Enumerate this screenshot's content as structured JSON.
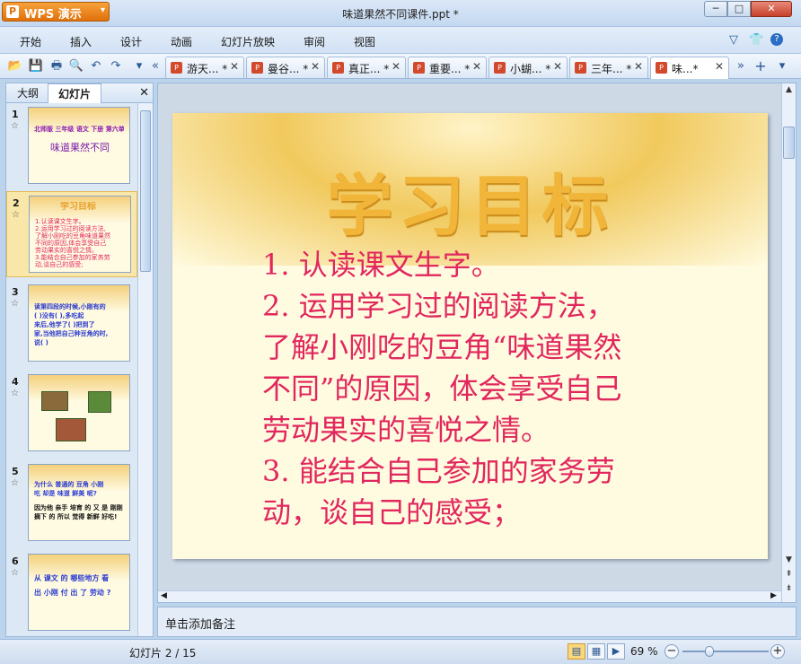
{
  "app": {
    "name": "WPS 演示",
    "logo_letter": "P",
    "doc_title": "味道果然不同课件.ppt *",
    "window_controls": {
      "minimize": "─",
      "maximize": "□",
      "close": "✕"
    }
  },
  "menu": {
    "items": [
      "开始",
      "插入",
      "设计",
      "动画",
      "幻灯片放映",
      "审阅",
      "视图"
    ],
    "right_icons": [
      "▽",
      "👕",
      "?"
    ]
  },
  "toolbar": {
    "icons": [
      "open-icon",
      "save-icon",
      "print-icon",
      "preview-icon",
      "undo-icon",
      "redo-icon",
      "dropdown-icon",
      "tab-prev-icon"
    ],
    "glyphs": [
      "📂",
      "💾",
      "🖶",
      "🔍",
      "↶",
      "↷",
      "▾",
      "«"
    ],
    "tab_next": "»",
    "new_tab": "+",
    "tab_menu": "▾",
    "tabs": [
      {
        "label": "游天... *",
        "close": "✕"
      },
      {
        "label": "曼谷... *",
        "close": "✕"
      },
      {
        "label": "真正... *",
        "close": "✕"
      },
      {
        "label": "重要... *",
        "close": "✕"
      },
      {
        "label": "小蝴... *",
        "close": "✕"
      },
      {
        "label": "三年... *",
        "close": "✕"
      },
      {
        "label": "味...*",
        "close": "✕"
      }
    ]
  },
  "side_panel": {
    "tab_outline": "大纲",
    "tab_slides": "幻灯片",
    "close": "✕",
    "star": "☆",
    "thumbnails": [
      {
        "num": "1",
        "lines": [
          "北师版 三年级 语文 下册 第六单元",
          "味道果然不同"
        ]
      },
      {
        "num": "2",
        "lines": [
          "学习目标",
          "1.认读课文生字。",
          "2.运用学习过的阅读方法,",
          "了解小刚吃的豆角味道果然",
          "不同的原因,体会享受自己",
          "劳动果实的喜悦之情。",
          "3.能结合自己参加的家务劳",
          "动,谈自己的感受;"
        ]
      },
      {
        "num": "3",
        "lines": [
          "读第四段的时候,小刚有的",
          "( )没有( ),多吃起",
          "来后,他学了( )把到了",
          "家,当他把自己种豆角的时,",
          "说( )"
        ]
      },
      {
        "num": "4",
        "lines": []
      },
      {
        "num": "5",
        "lines": [
          "为什么 普通的 豆角 小刚",
          "吃 却是 味道 鲜美 呢?",
          "因为他 亲手 培育 的 又 是 刚刚",
          "摘下 的 所以 觉得 新鲜 好吃!"
        ]
      },
      {
        "num": "6",
        "lines": [
          "从 课文 的 哪些地方 看",
          "出 小刚 付 出 了 劳动 ?"
        ]
      }
    ]
  },
  "slide": {
    "title": "学习目标",
    "lines": [
      "1. 认读课文生字。",
      "2. 运用学习过的阅读方法，",
      "了解小刚吃的豆角“味道果然",
      "不同”的原因，体会享受自己",
      "劳动果实的喜悦之情。",
      "3. 能结合自己参加的家务劳",
      "动，谈自己的感受；"
    ],
    "colors": {
      "title": "#f1b53a",
      "body": "#e1275d",
      "background": "#fffbe0"
    }
  },
  "notes": {
    "placeholder": "单击添加备注"
  },
  "status": {
    "slide_count": "幻灯片 2 / 15",
    "zoom": "69 %",
    "zoom_level_percent": 69,
    "zoom_minus": "−",
    "zoom_plus": "+",
    "view_glyphs": [
      "▤",
      "▦",
      "▶"
    ]
  },
  "scroll": {
    "up": "▲",
    "down": "▼",
    "left": "◀",
    "right": "▶",
    "page_up": "⇞",
    "page_down": "⇟"
  }
}
